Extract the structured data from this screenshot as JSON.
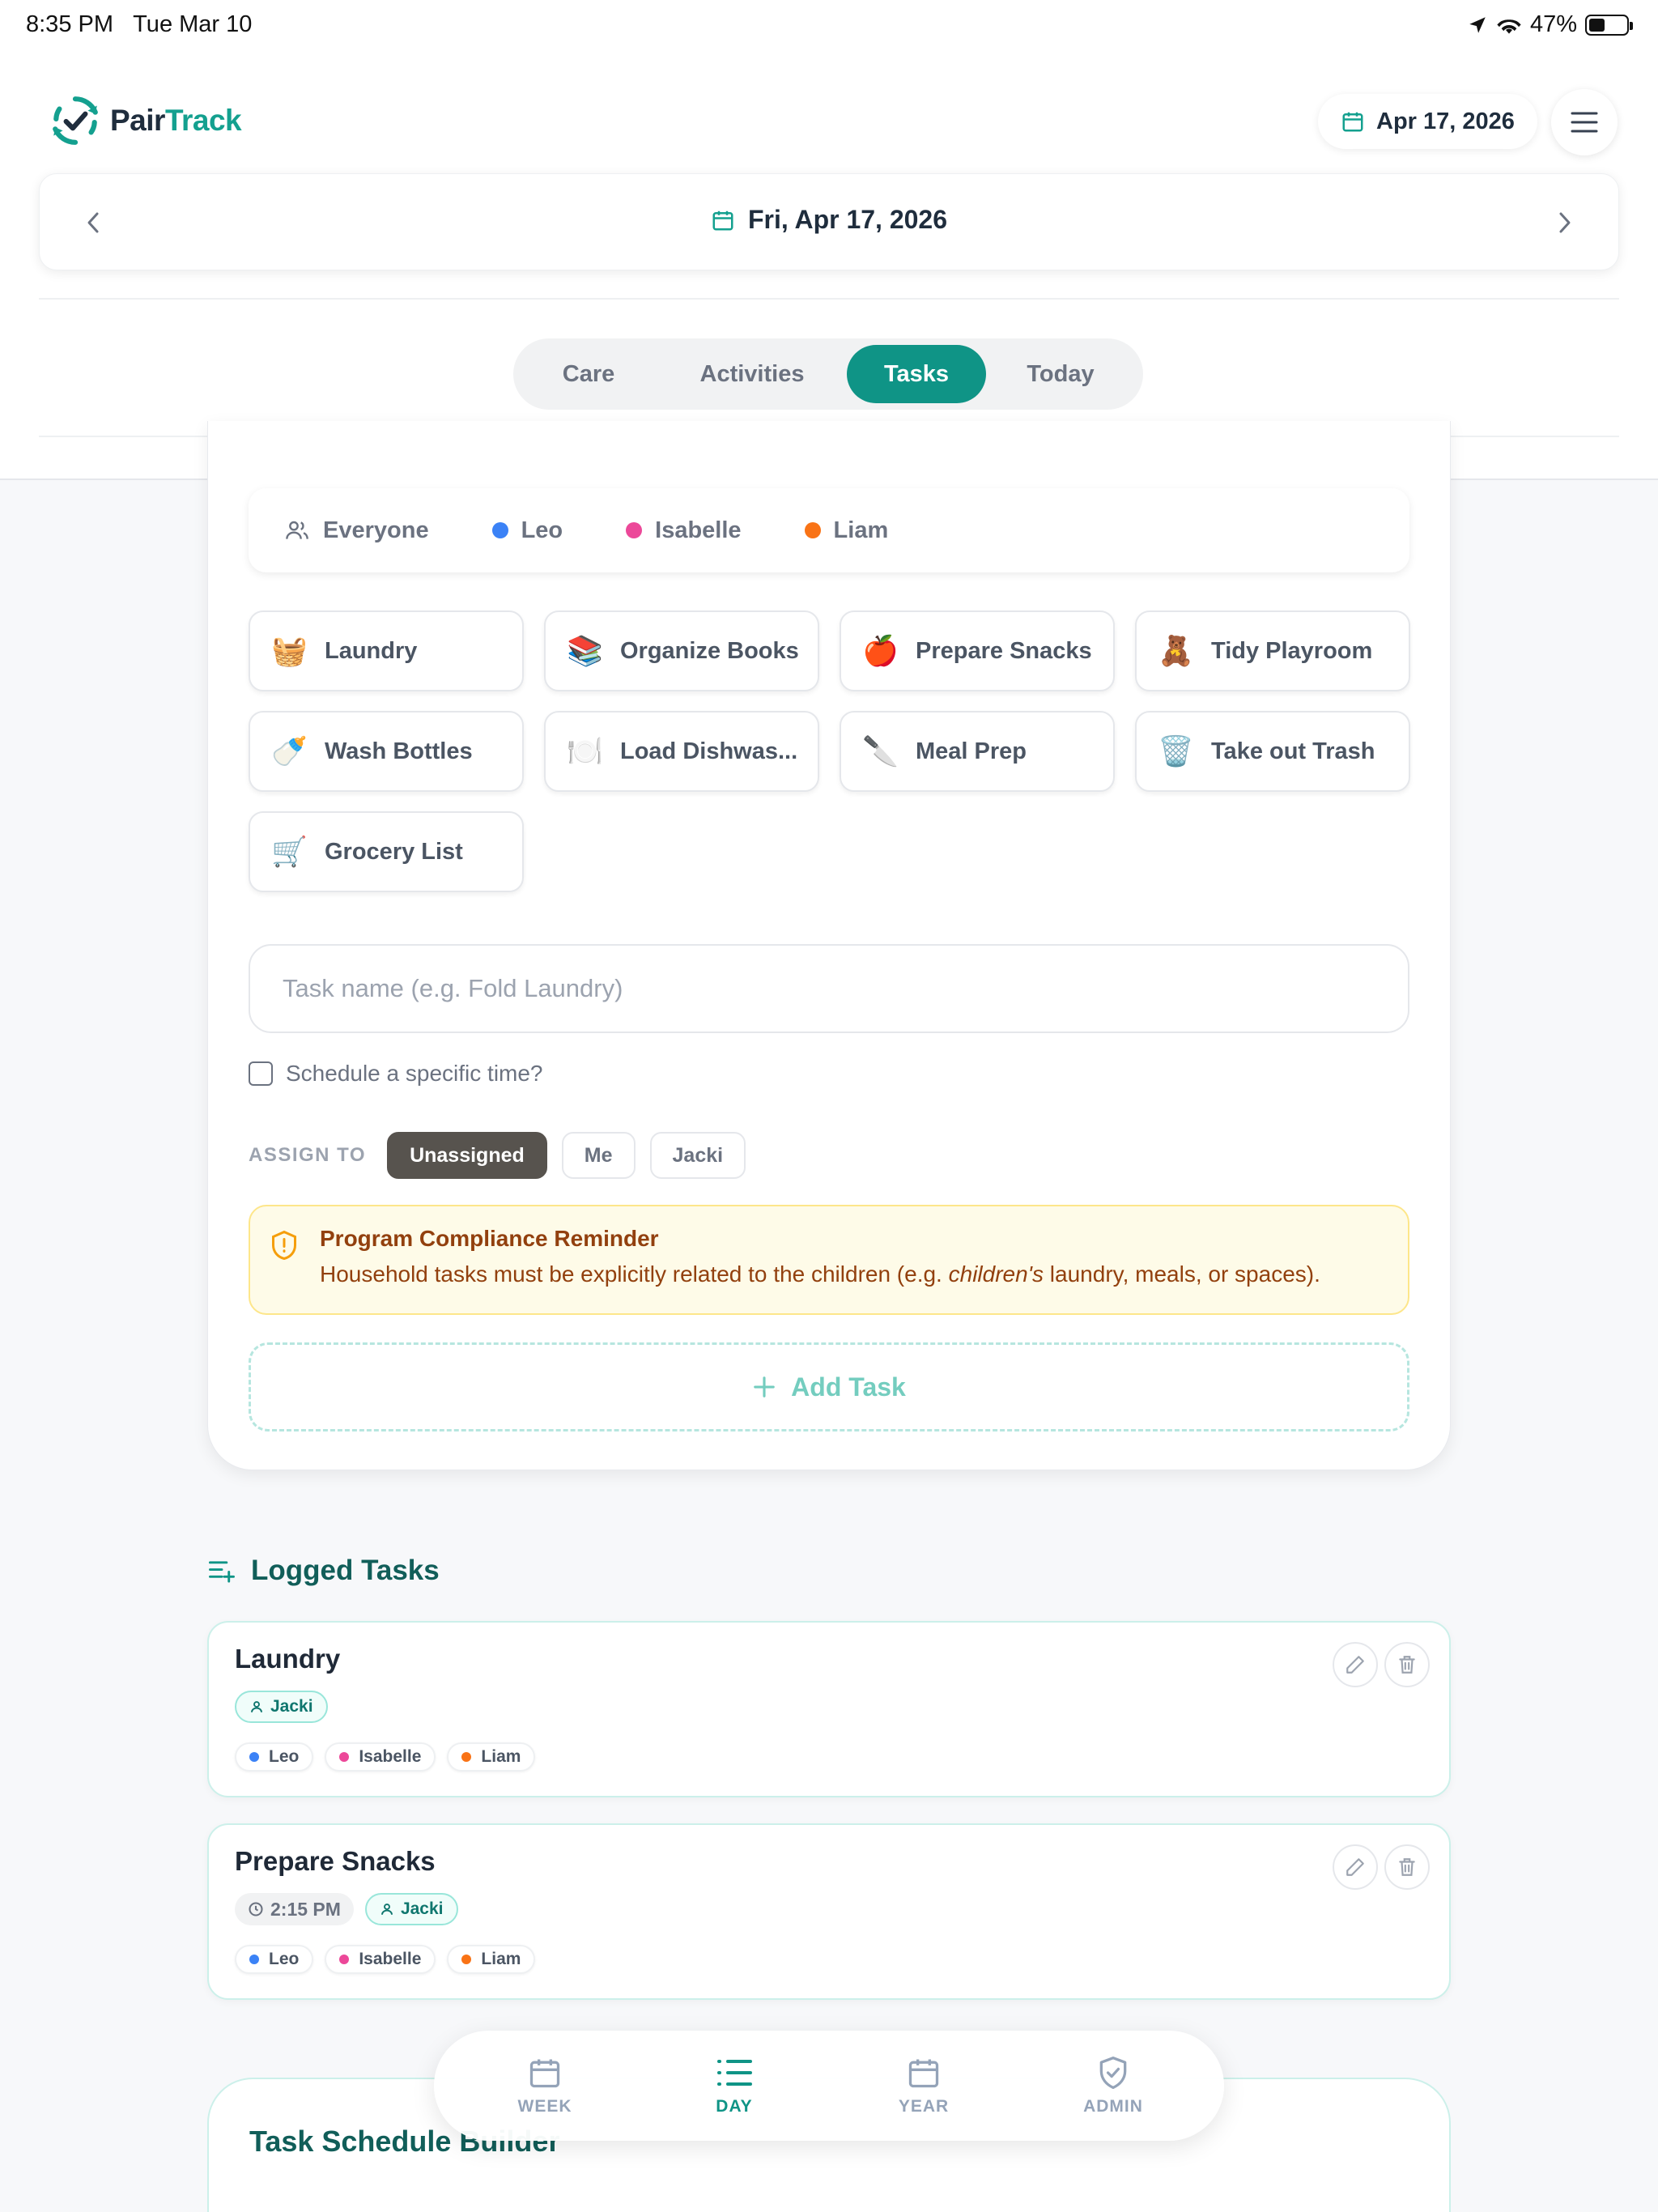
{
  "status_bar": {
    "time": "8:35 PM",
    "date": "Tue Mar 10",
    "battery": "47%"
  },
  "header": {
    "logo_pair": "Pair",
    "logo_track": "Track",
    "date_pill": "Apr 17, 2026",
    "day_title": "Fri, Apr 17, 2026",
    "tabs": [
      {
        "label": "Care"
      },
      {
        "label": "Activities"
      },
      {
        "label": "Tasks"
      },
      {
        "label": "Today"
      }
    ],
    "active_tab": "Tasks"
  },
  "children_filter": {
    "everyone": "Everyone",
    "children": [
      {
        "name": "Leo",
        "color": "#3b82f6"
      },
      {
        "name": "Isabelle",
        "color": "#ec4899"
      },
      {
        "name": "Liam",
        "color": "#f97316"
      }
    ]
  },
  "quick_tasks": [
    {
      "emoji": "🧺",
      "label": "Laundry"
    },
    {
      "emoji": "📚",
      "label": "Organize Books"
    },
    {
      "emoji": "🍎",
      "label": "Prepare Snacks"
    },
    {
      "emoji": "🧸",
      "label": "Tidy Playroom"
    },
    {
      "emoji": "🍼",
      "label": "Wash Bottles"
    },
    {
      "emoji": "🍽️",
      "label": "Load Dishwas..."
    },
    {
      "emoji": "🔪",
      "label": "Meal Prep"
    },
    {
      "emoji": "🗑️",
      "label": "Take out Trash"
    },
    {
      "emoji": "🛒",
      "label": "Grocery List"
    }
  ],
  "form": {
    "task_placeholder": "Task name (e.g. Fold Laundry)",
    "schedule_label": "Schedule a specific time?",
    "assign_label": "ASSIGN TO",
    "assign_options": [
      "Unassigned",
      "Me",
      "Jacki"
    ],
    "assign_selected": "Unassigned",
    "notice_title": "Program Compliance Reminder",
    "notice_body_prefix": "Household tasks must be explicitly related to the children (e.g. ",
    "notice_body_em": "children's",
    "notice_body_suffix": " laundry, meals, or spaces).",
    "add_task": "Add Task"
  },
  "logged": {
    "title": "Logged Tasks",
    "tasks": [
      {
        "name": "Laundry",
        "assignee": "Jacki",
        "kids": [
          "Leo",
          "Isabelle",
          "Liam"
        ]
      },
      {
        "name": "Prepare Snacks",
        "time": "2:15 PM",
        "assignee": "Jacki",
        "kids": [
          "Leo",
          "Isabelle",
          "Liam"
        ]
      }
    ]
  },
  "builder": {
    "title": "Task Schedule Builder"
  },
  "bottom_nav": [
    {
      "label": "WEEK",
      "icon": "calendar-icon"
    },
    {
      "label": "DAY",
      "icon": "list-icon"
    },
    {
      "label": "YEAR",
      "icon": "calendar-icon"
    },
    {
      "label": "ADMIN",
      "icon": "shield-check-icon"
    }
  ],
  "bottom_nav_active": "DAY",
  "colors": {
    "accent": "#0f9486",
    "leo": "#3b82f6",
    "isabelle": "#ec4899",
    "liam": "#f97316"
  }
}
